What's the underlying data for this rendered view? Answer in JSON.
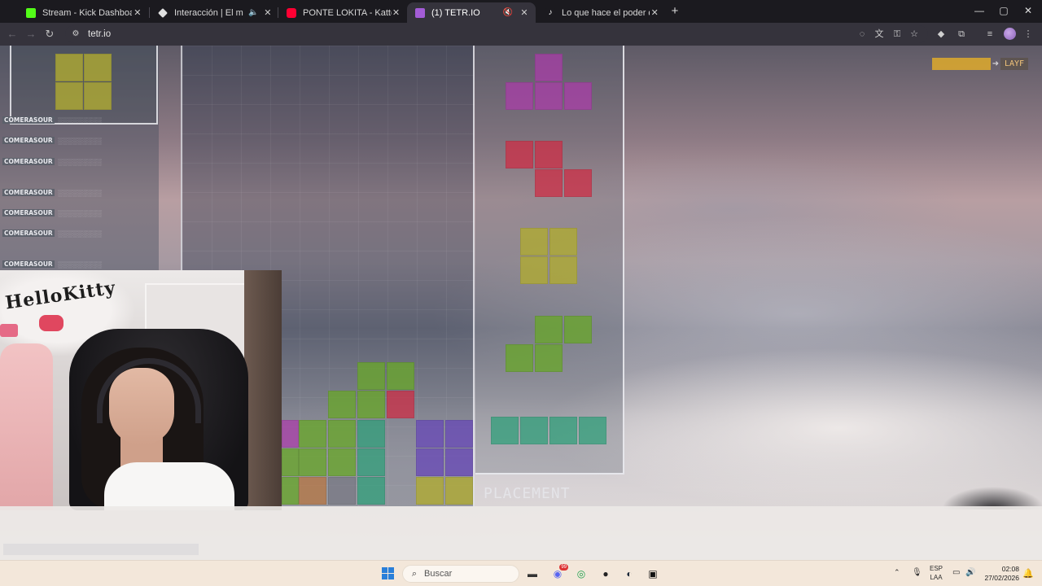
{
  "browser": {
    "tabs": [
      {
        "title": "Stream - Kick Dashboard",
        "favicon": "kick-icon",
        "color": "#53fc18",
        "active": false,
        "muted": false
      },
      {
        "title": "Interacción | El mejor softw",
        "favicon": "diamond-icon",
        "color": "#e0e0e0",
        "active": false,
        "muted": true
      },
      {
        "title": "PONTE LOKITA - Katteyes x Kic",
        "favicon": "youtube-icon",
        "color": "#ff0033",
        "active": false,
        "muted": false
      },
      {
        "title": "(1) TETR.IO",
        "favicon": "tetrio-icon",
        "color": "#a35cd6",
        "active": true,
        "muted": true
      },
      {
        "title": "Lo que hace el poder del diner",
        "favicon": "tiktok-icon",
        "color": "#ffffff",
        "active": false,
        "muted": false
      }
    ],
    "url": "tetr.io",
    "new_tab_symbol": "+",
    "window_controls": {
      "minimize": "—",
      "maximize": "▢",
      "close": "✕"
    }
  },
  "game": {
    "placement_label": "PLACEMENT",
    "badge_label": "LAYF",
    "chat_usernames": [
      "COMERASOUR",
      "COMERASOUR",
      "COMERASOUR",
      "COMERASOUR",
      "COMERASOUR",
      "COMERASOUR",
      "COMERASOUR"
    ],
    "colors": {
      "purple": "#ac3caa",
      "red": "#cd2d46",
      "yellow": "#afaa32",
      "green": "#69a52d",
      "teal": "#2da078",
      "violet": "#6441b9"
    }
  },
  "webcam": {
    "banner_text": "HelloKitty"
  },
  "taskbar": {
    "search_placeholder": "Buscar",
    "language": "ESP",
    "language_sub": "LAA",
    "time": "02:08",
    "date": "27/02/2026",
    "app_icons": [
      "file-explorer-icon",
      "discord-icon",
      "chrome-icon",
      "media-app-icon",
      "steam-icon",
      "epic-games-icon"
    ],
    "discord_badge": "99"
  }
}
